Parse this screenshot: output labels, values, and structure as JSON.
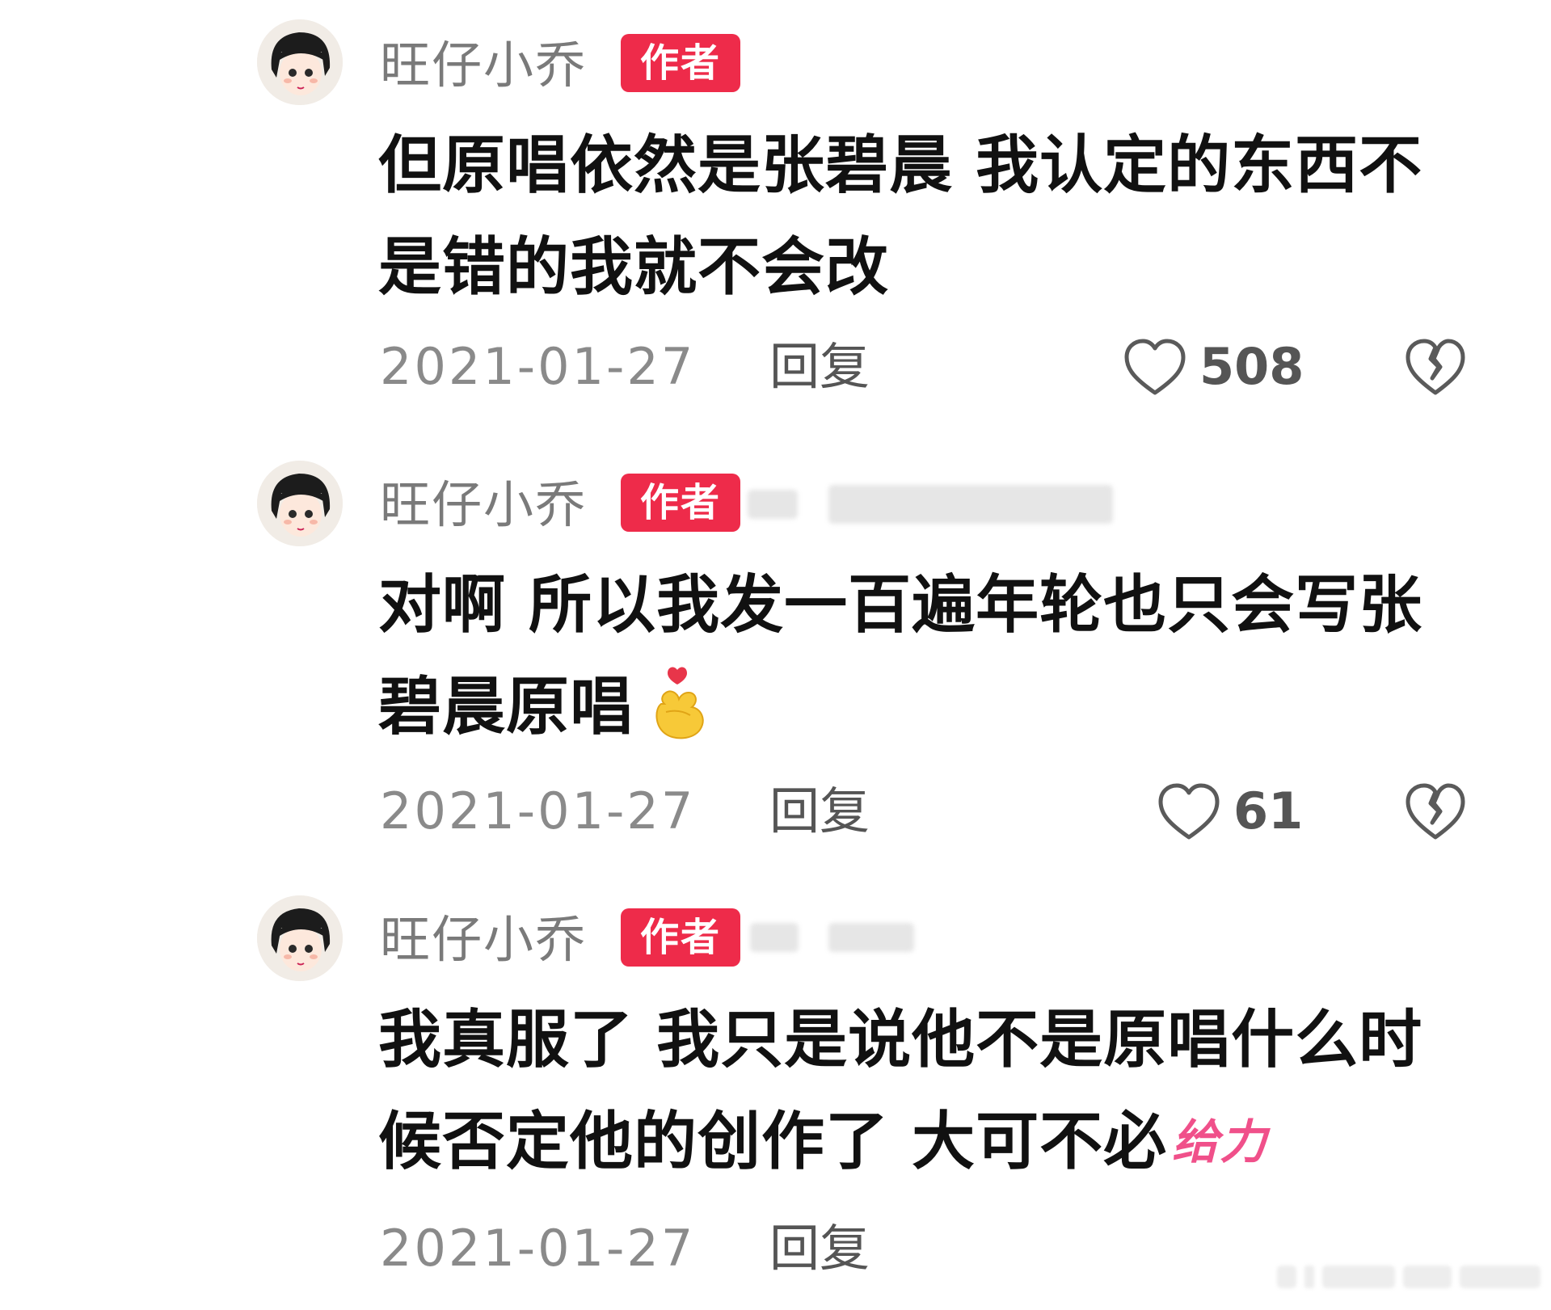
{
  "comments": [
    {
      "username": "旺仔小乔",
      "badge": "作者",
      "text": "但原唱依然是张碧晨 我认定的东西不是错的我就不会改",
      "date": "2021-01-27",
      "reply_label": "回复",
      "likes": "508",
      "emoji_icon": null,
      "sticker": null
    },
    {
      "username": "旺仔小乔",
      "badge": "作者",
      "text": "对啊 所以我发一百遍年轮也只会写张碧晨原唱",
      "date": "2021-01-27",
      "reply_label": "回复",
      "likes": "61",
      "emoji_icon": "finger-heart-icon",
      "sticker": null
    },
    {
      "username": "旺仔小乔",
      "badge": "作者",
      "text": "我真服了 我只是说他不是原唱什么时候否定他的创作了 大可不必",
      "date": "2021-01-27",
      "reply_label": "回复",
      "likes": null,
      "emoji_icon": null,
      "sticker": "给力"
    }
  ],
  "colors": {
    "badge_bg": "#ee2b4a",
    "sticker": "#f0508a",
    "meta_text": "#8a8a8a"
  }
}
